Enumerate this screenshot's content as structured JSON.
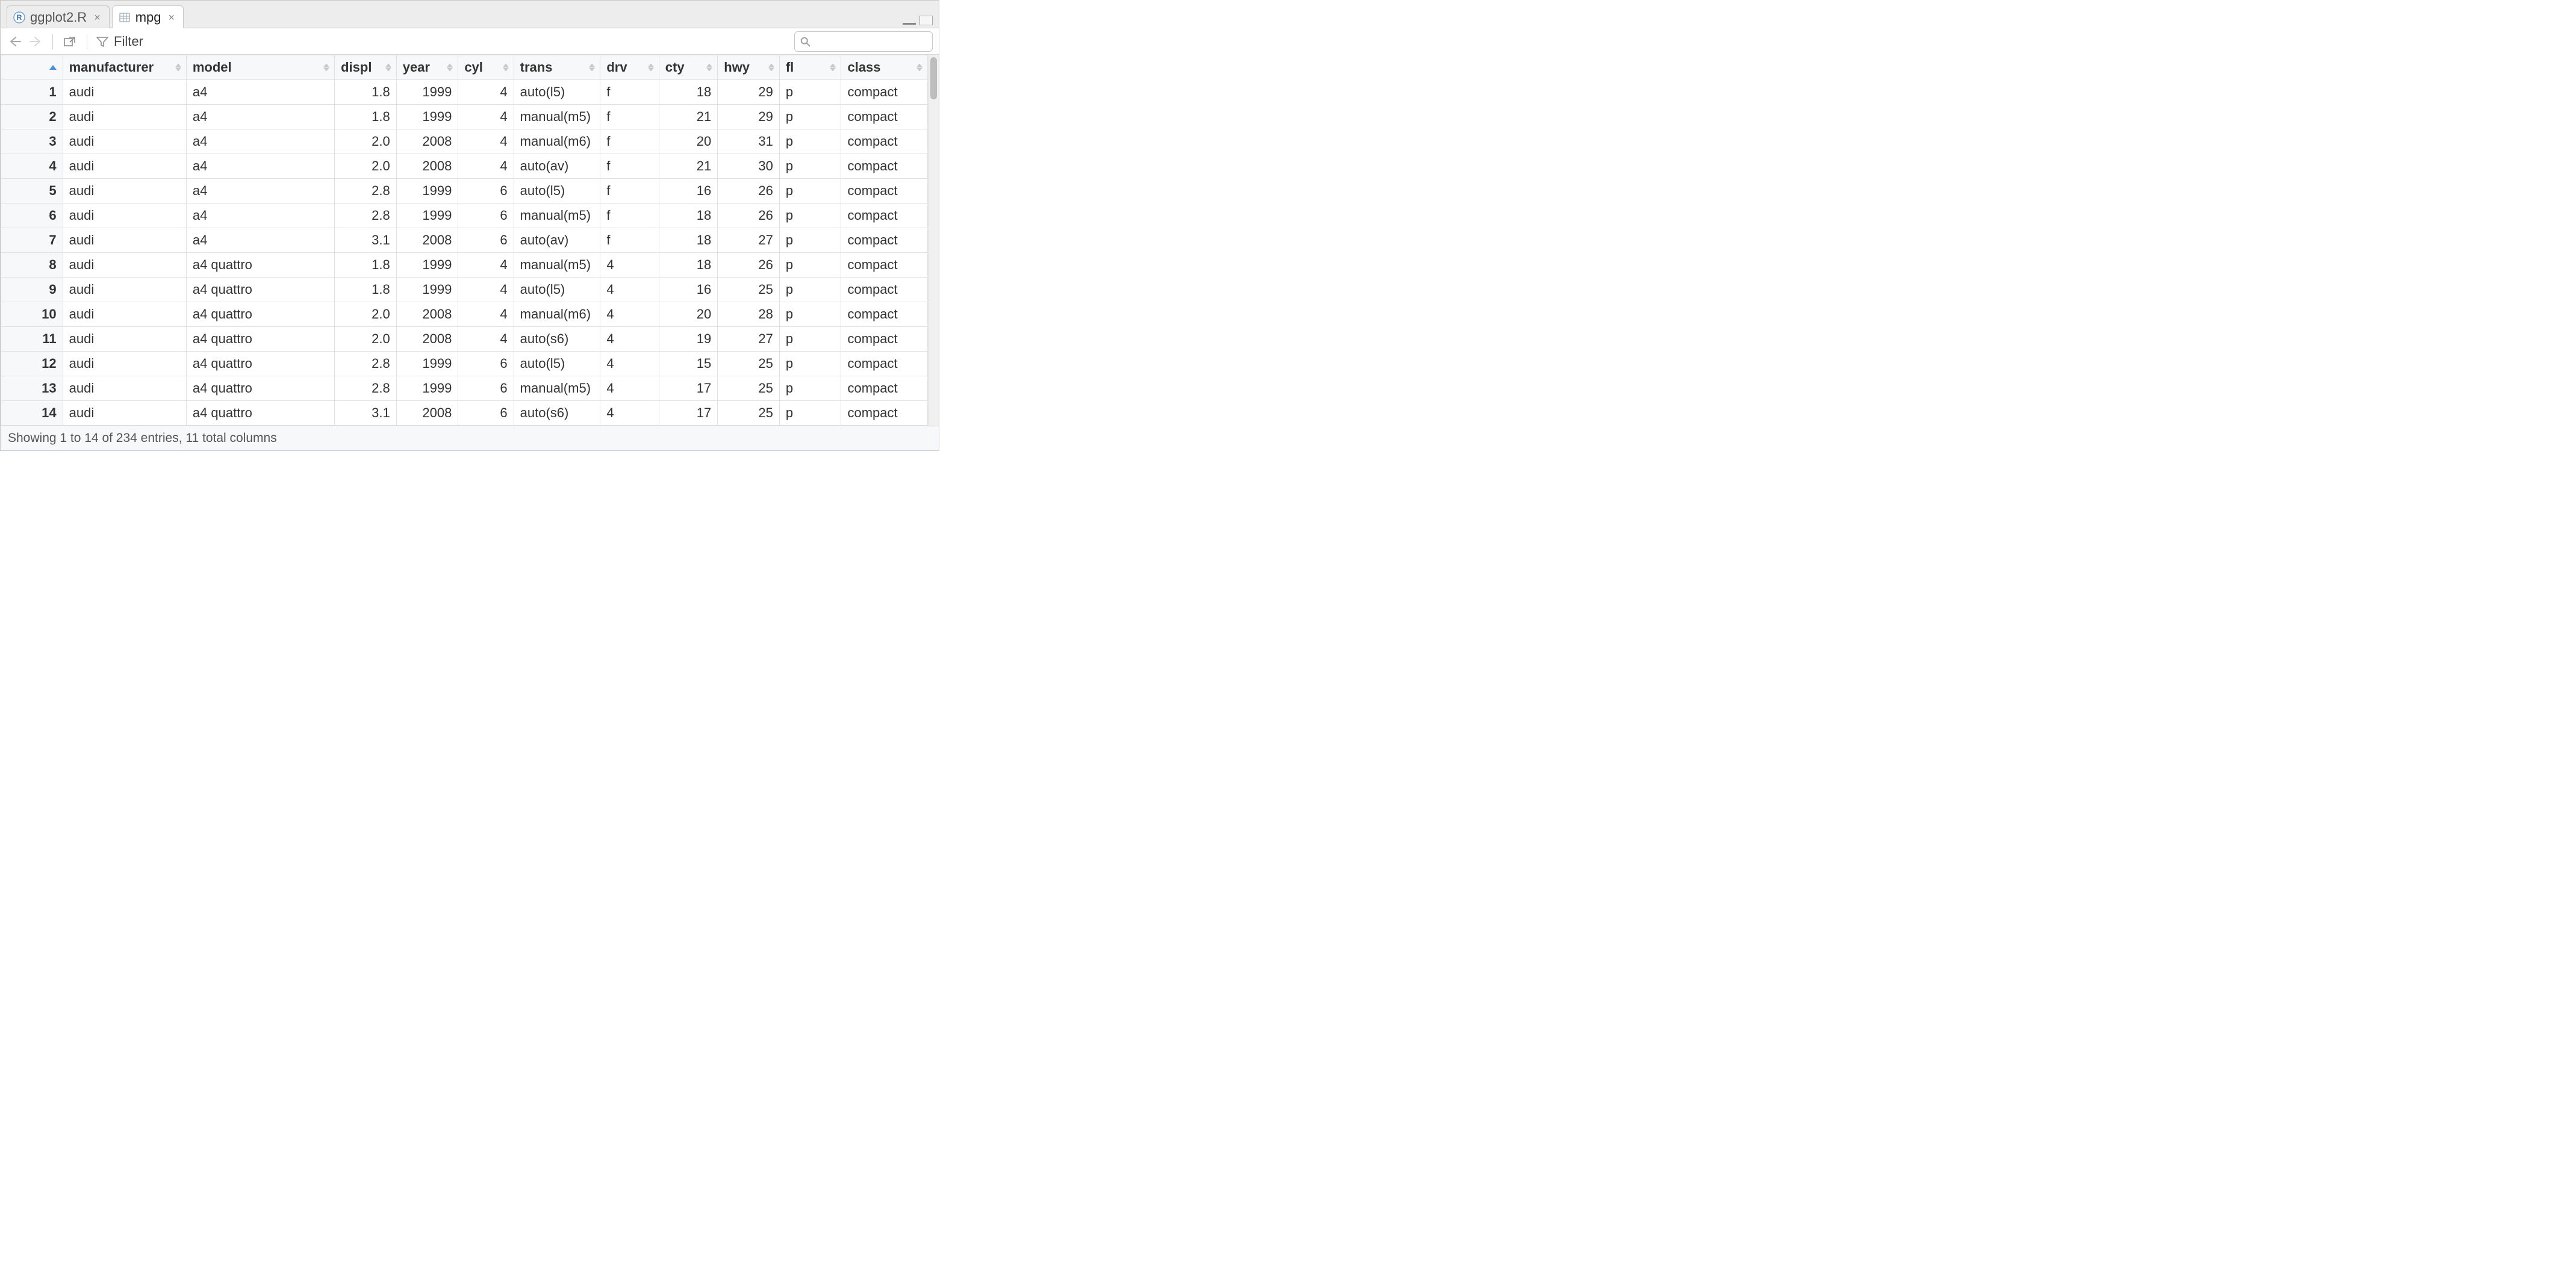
{
  "tabs": [
    {
      "label": "ggplot2.R",
      "active": false,
      "icontype": "rscript"
    },
    {
      "label": "mpg",
      "active": true,
      "icontype": "dataframe"
    }
  ],
  "toolbar": {
    "filter_label": "Filter",
    "search_placeholder": ""
  },
  "columns": [
    {
      "key": "manufacturer",
      "label": "manufacturer",
      "align": "left"
    },
    {
      "key": "model",
      "label": "model",
      "align": "left"
    },
    {
      "key": "displ",
      "label": "displ",
      "align": "right"
    },
    {
      "key": "year",
      "label": "year",
      "align": "right"
    },
    {
      "key": "cyl",
      "label": "cyl",
      "align": "right"
    },
    {
      "key": "trans",
      "label": "trans",
      "align": "left"
    },
    {
      "key": "drv",
      "label": "drv",
      "align": "left"
    },
    {
      "key": "cty",
      "label": "cty",
      "align": "right"
    },
    {
      "key": "hwy",
      "label": "hwy",
      "align": "right"
    },
    {
      "key": "fl",
      "label": "fl",
      "align": "left"
    },
    {
      "key": "class",
      "label": "class",
      "align": "left"
    }
  ],
  "rows": [
    {
      "n": 1,
      "manufacturer": "audi",
      "model": "a4",
      "displ": "1.8",
      "year": "1999",
      "cyl": "4",
      "trans": "auto(l5)",
      "drv": "f",
      "cty": "18",
      "hwy": "29",
      "fl": "p",
      "class": "compact"
    },
    {
      "n": 2,
      "manufacturer": "audi",
      "model": "a4",
      "displ": "1.8",
      "year": "1999",
      "cyl": "4",
      "trans": "manual(m5)",
      "drv": "f",
      "cty": "21",
      "hwy": "29",
      "fl": "p",
      "class": "compact"
    },
    {
      "n": 3,
      "manufacturer": "audi",
      "model": "a4",
      "displ": "2.0",
      "year": "2008",
      "cyl": "4",
      "trans": "manual(m6)",
      "drv": "f",
      "cty": "20",
      "hwy": "31",
      "fl": "p",
      "class": "compact"
    },
    {
      "n": 4,
      "manufacturer": "audi",
      "model": "a4",
      "displ": "2.0",
      "year": "2008",
      "cyl": "4",
      "trans": "auto(av)",
      "drv": "f",
      "cty": "21",
      "hwy": "30",
      "fl": "p",
      "class": "compact"
    },
    {
      "n": 5,
      "manufacturer": "audi",
      "model": "a4",
      "displ": "2.8",
      "year": "1999",
      "cyl": "6",
      "trans": "auto(l5)",
      "drv": "f",
      "cty": "16",
      "hwy": "26",
      "fl": "p",
      "class": "compact"
    },
    {
      "n": 6,
      "manufacturer": "audi",
      "model": "a4",
      "displ": "2.8",
      "year": "1999",
      "cyl": "6",
      "trans": "manual(m5)",
      "drv": "f",
      "cty": "18",
      "hwy": "26",
      "fl": "p",
      "class": "compact"
    },
    {
      "n": 7,
      "manufacturer": "audi",
      "model": "a4",
      "displ": "3.1",
      "year": "2008",
      "cyl": "6",
      "trans": "auto(av)",
      "drv": "f",
      "cty": "18",
      "hwy": "27",
      "fl": "p",
      "class": "compact"
    },
    {
      "n": 8,
      "manufacturer": "audi",
      "model": "a4 quattro",
      "displ": "1.8",
      "year": "1999",
      "cyl": "4",
      "trans": "manual(m5)",
      "drv": "4",
      "cty": "18",
      "hwy": "26",
      "fl": "p",
      "class": "compact"
    },
    {
      "n": 9,
      "manufacturer": "audi",
      "model": "a4 quattro",
      "displ": "1.8",
      "year": "1999",
      "cyl": "4",
      "trans": "auto(l5)",
      "drv": "4",
      "cty": "16",
      "hwy": "25",
      "fl": "p",
      "class": "compact"
    },
    {
      "n": 10,
      "manufacturer": "audi",
      "model": "a4 quattro",
      "displ": "2.0",
      "year": "2008",
      "cyl": "4",
      "trans": "manual(m6)",
      "drv": "4",
      "cty": "20",
      "hwy": "28",
      "fl": "p",
      "class": "compact"
    },
    {
      "n": 11,
      "manufacturer": "audi",
      "model": "a4 quattro",
      "displ": "2.0",
      "year": "2008",
      "cyl": "4",
      "trans": "auto(s6)",
      "drv": "4",
      "cty": "19",
      "hwy": "27",
      "fl": "p",
      "class": "compact"
    },
    {
      "n": 12,
      "manufacturer": "audi",
      "model": "a4 quattro",
      "displ": "2.8",
      "year": "1999",
      "cyl": "6",
      "trans": "auto(l5)",
      "drv": "4",
      "cty": "15",
      "hwy": "25",
      "fl": "p",
      "class": "compact"
    },
    {
      "n": 13,
      "manufacturer": "audi",
      "model": "a4 quattro",
      "displ": "2.8",
      "year": "1999",
      "cyl": "6",
      "trans": "manual(m5)",
      "drv": "4",
      "cty": "17",
      "hwy": "25",
      "fl": "p",
      "class": "compact"
    },
    {
      "n": 14,
      "manufacturer": "audi",
      "model": "a4 quattro",
      "displ": "3.1",
      "year": "2008",
      "cyl": "6",
      "trans": "auto(s6)",
      "drv": "4",
      "cty": "17",
      "hwy": "25",
      "fl": "p",
      "class": "compact"
    }
  ],
  "status": {
    "text": "Showing 1 to 14 of 234 entries, 11 total columns"
  }
}
